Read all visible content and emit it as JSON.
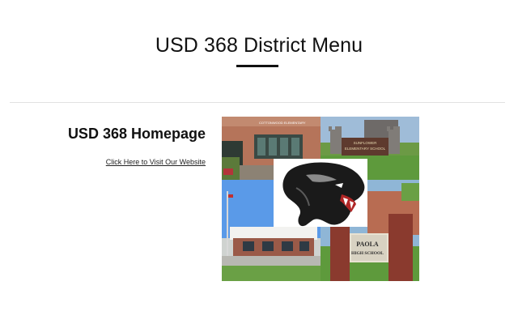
{
  "header": {
    "title": "USD 368 District Menu"
  },
  "menu_card": {
    "heading": "USD 368 Homepage",
    "link_text": "Click Here to Visit Our Website",
    "image": {
      "sign_elementary_line1": "SUNFLOWER",
      "sign_elementary_line2": "ELEMENTARY SCHOOL",
      "sign_high_line1": "PAOLA",
      "sign_high_line2": "HIGH SCHOOL",
      "building_sign": "COTTONWOOD ELEMENTARY",
      "mascot": "panther-head-logo"
    }
  },
  "colors": {
    "text": "#111111",
    "divider": "#e2e2e2",
    "background": "#ffffff"
  }
}
